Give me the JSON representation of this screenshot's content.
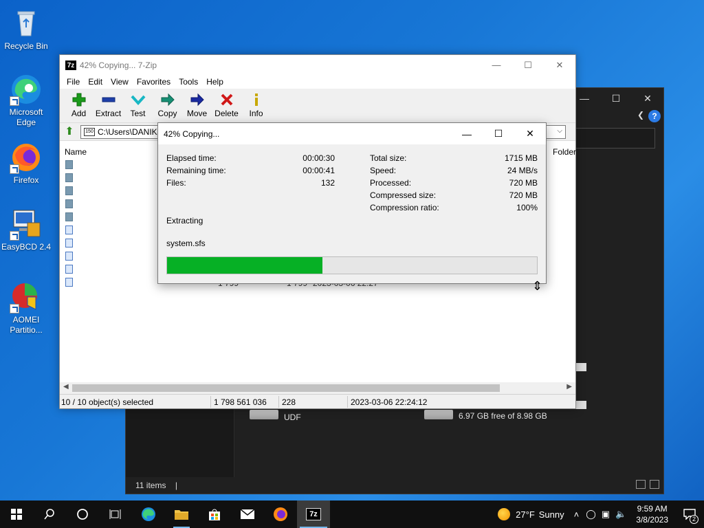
{
  "desktop": {
    "icons": [
      {
        "label": "Recycle Bin"
      },
      {
        "label": "Microsoft Edge"
      },
      {
        "label": "Firefox"
      },
      {
        "label": "EasyBCD 2.4"
      },
      {
        "label": "AOMEI Partitio..."
      }
    ]
  },
  "explorer_bg": {
    "status_items": "11 items",
    "drive1_label": "UDF",
    "drive2_free": "6.97 GB free of 8.98 GB"
  },
  "sevenzip": {
    "title": "42% Copying... 7-Zip",
    "app_icon": "7z",
    "menu": [
      "File",
      "Edit",
      "View",
      "Favorites",
      "Tools",
      "Help"
    ],
    "toolbar": [
      {
        "label": "Add",
        "icon": "plus-icon",
        "color": "#1a9a1a"
      },
      {
        "label": "Extract",
        "icon": "minus-icon",
        "color": "#1f3fa8"
      },
      {
        "label": "Test",
        "icon": "check-down-icon",
        "color": "#18b7c4"
      },
      {
        "label": "Copy",
        "icon": "copy-arrow-icon",
        "color": "#178f74"
      },
      {
        "label": "Move",
        "icon": "move-arrow-icon",
        "color": "#1a2aa0"
      },
      {
        "label": "Delete",
        "icon": "delete-x-icon",
        "color": "#d01818"
      },
      {
        "label": "Info",
        "icon": "info-icon",
        "color": "#c8a800"
      }
    ],
    "address": "C:\\Users\\DANIKY",
    "columns": {
      "name": "Name",
      "folder": "Folder"
    },
    "row_fragment": {
      "size": "1 799",
      "packed": "1 799",
      "date": "2023-03-06 22:27"
    },
    "status": {
      "selected": "10 / 10 object(s) selected",
      "size": "1 798 561 036",
      "count": "228",
      "modified": "2023-03-06 22:24:12"
    }
  },
  "dialog": {
    "title": "42% Copying...",
    "elapsed_label": "Elapsed time:",
    "elapsed_value": "00:00:30",
    "remaining_label": "Remaining time:",
    "remaining_value": "00:00:41",
    "files_label": "Files:",
    "files_value": "132",
    "total_label": "Total size:",
    "total_value": "1715 MB",
    "speed_label": "Speed:",
    "speed_value": "24 MB/s",
    "processed_label": "Processed:",
    "processed_value": "720 MB",
    "compressed_label": "Compressed size:",
    "compressed_value": "720 MB",
    "ratio_label": "Compression ratio:",
    "ratio_value": "100%",
    "operation": "Extracting",
    "current_file": "system.sfs",
    "progress_fraction": 0.42,
    "progress_color": "#06b025"
  },
  "taskbar": {
    "weather_temp": "27°F",
    "weather_desc": "Sunny",
    "time": "9:59 AM",
    "date": "3/8/2023",
    "notification_count": "2"
  }
}
